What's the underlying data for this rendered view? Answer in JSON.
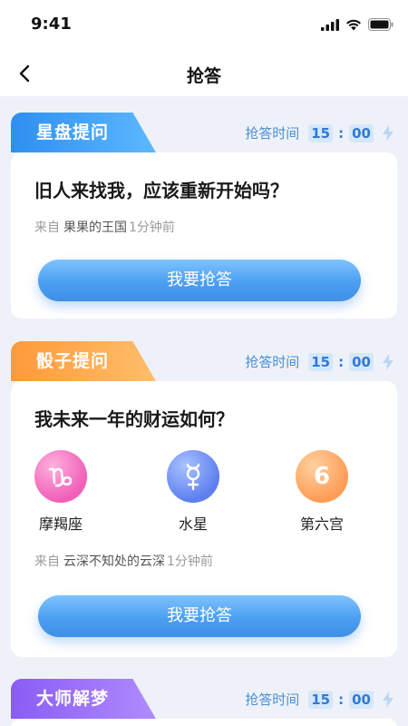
{
  "status_bar": {
    "time": "9:41"
  },
  "nav": {
    "title": "抢答"
  },
  "sections": [
    {
      "tag": "星盘提问",
      "timer": {
        "label": "抢答时间",
        "minutes": "15",
        "seconds": "00"
      },
      "question": "旧人来找我，应该重新开始吗？",
      "meta": {
        "prefix": "来自",
        "author": "果果的王国",
        "time": "1分钟前"
      },
      "button": "我要抢答",
      "color": "#3a97f2"
    },
    {
      "tag": "骰子提问",
      "timer": {
        "label": "抢答时间",
        "minutes": "15",
        "seconds": "00"
      },
      "question": "我未来一年的财运如何？",
      "dice": [
        {
          "icon": "capricorn-icon",
          "label": "摩羯座"
        },
        {
          "icon": "mercury-icon",
          "label": "水星"
        },
        {
          "icon": "house-six-icon",
          "label": "第六宫",
          "glyph": "6"
        }
      ],
      "meta": {
        "prefix": "来自",
        "author": "云深不知处的云深",
        "time": "1分钟前"
      },
      "button": "我要抢答",
      "color": "#ff9f45"
    },
    {
      "tag": "大师解梦",
      "timer": {
        "label": "抢答时间",
        "minutes": "15",
        "seconds": "00"
      },
      "color": "#9466f7"
    }
  ]
}
